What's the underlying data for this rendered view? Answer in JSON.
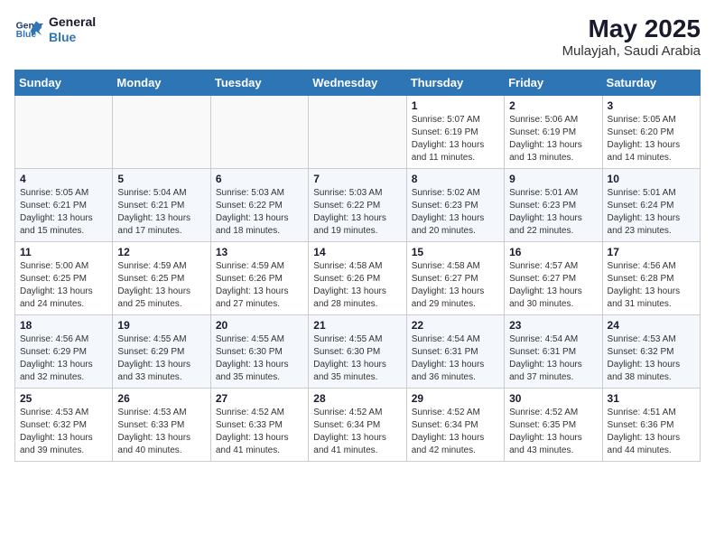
{
  "header": {
    "logo_line1": "General",
    "logo_line2": "Blue",
    "title": "May 2025",
    "subtitle": "Mulayjah, Saudi Arabia"
  },
  "weekdays": [
    "Sunday",
    "Monday",
    "Tuesday",
    "Wednesday",
    "Thursday",
    "Friday",
    "Saturday"
  ],
  "weeks": [
    [
      {
        "day": "",
        "info": ""
      },
      {
        "day": "",
        "info": ""
      },
      {
        "day": "",
        "info": ""
      },
      {
        "day": "",
        "info": ""
      },
      {
        "day": "1",
        "info": "Sunrise: 5:07 AM\nSunset: 6:19 PM\nDaylight: 13 hours\nand 11 minutes."
      },
      {
        "day": "2",
        "info": "Sunrise: 5:06 AM\nSunset: 6:19 PM\nDaylight: 13 hours\nand 13 minutes."
      },
      {
        "day": "3",
        "info": "Sunrise: 5:05 AM\nSunset: 6:20 PM\nDaylight: 13 hours\nand 14 minutes."
      }
    ],
    [
      {
        "day": "4",
        "info": "Sunrise: 5:05 AM\nSunset: 6:21 PM\nDaylight: 13 hours\nand 15 minutes."
      },
      {
        "day": "5",
        "info": "Sunrise: 5:04 AM\nSunset: 6:21 PM\nDaylight: 13 hours\nand 17 minutes."
      },
      {
        "day": "6",
        "info": "Sunrise: 5:03 AM\nSunset: 6:22 PM\nDaylight: 13 hours\nand 18 minutes."
      },
      {
        "day": "7",
        "info": "Sunrise: 5:03 AM\nSunset: 6:22 PM\nDaylight: 13 hours\nand 19 minutes."
      },
      {
        "day": "8",
        "info": "Sunrise: 5:02 AM\nSunset: 6:23 PM\nDaylight: 13 hours\nand 20 minutes."
      },
      {
        "day": "9",
        "info": "Sunrise: 5:01 AM\nSunset: 6:23 PM\nDaylight: 13 hours\nand 22 minutes."
      },
      {
        "day": "10",
        "info": "Sunrise: 5:01 AM\nSunset: 6:24 PM\nDaylight: 13 hours\nand 23 minutes."
      }
    ],
    [
      {
        "day": "11",
        "info": "Sunrise: 5:00 AM\nSunset: 6:25 PM\nDaylight: 13 hours\nand 24 minutes."
      },
      {
        "day": "12",
        "info": "Sunrise: 4:59 AM\nSunset: 6:25 PM\nDaylight: 13 hours\nand 25 minutes."
      },
      {
        "day": "13",
        "info": "Sunrise: 4:59 AM\nSunset: 6:26 PM\nDaylight: 13 hours\nand 27 minutes."
      },
      {
        "day": "14",
        "info": "Sunrise: 4:58 AM\nSunset: 6:26 PM\nDaylight: 13 hours\nand 28 minutes."
      },
      {
        "day": "15",
        "info": "Sunrise: 4:58 AM\nSunset: 6:27 PM\nDaylight: 13 hours\nand 29 minutes."
      },
      {
        "day": "16",
        "info": "Sunrise: 4:57 AM\nSunset: 6:27 PM\nDaylight: 13 hours\nand 30 minutes."
      },
      {
        "day": "17",
        "info": "Sunrise: 4:56 AM\nSunset: 6:28 PM\nDaylight: 13 hours\nand 31 minutes."
      }
    ],
    [
      {
        "day": "18",
        "info": "Sunrise: 4:56 AM\nSunset: 6:29 PM\nDaylight: 13 hours\nand 32 minutes."
      },
      {
        "day": "19",
        "info": "Sunrise: 4:55 AM\nSunset: 6:29 PM\nDaylight: 13 hours\nand 33 minutes."
      },
      {
        "day": "20",
        "info": "Sunrise: 4:55 AM\nSunset: 6:30 PM\nDaylight: 13 hours\nand 35 minutes."
      },
      {
        "day": "21",
        "info": "Sunrise: 4:55 AM\nSunset: 6:30 PM\nDaylight: 13 hours\nand 35 minutes."
      },
      {
        "day": "22",
        "info": "Sunrise: 4:54 AM\nSunset: 6:31 PM\nDaylight: 13 hours\nand 36 minutes."
      },
      {
        "day": "23",
        "info": "Sunrise: 4:54 AM\nSunset: 6:31 PM\nDaylight: 13 hours\nand 37 minutes."
      },
      {
        "day": "24",
        "info": "Sunrise: 4:53 AM\nSunset: 6:32 PM\nDaylight: 13 hours\nand 38 minutes."
      }
    ],
    [
      {
        "day": "25",
        "info": "Sunrise: 4:53 AM\nSunset: 6:32 PM\nDaylight: 13 hours\nand 39 minutes."
      },
      {
        "day": "26",
        "info": "Sunrise: 4:53 AM\nSunset: 6:33 PM\nDaylight: 13 hours\nand 40 minutes."
      },
      {
        "day": "27",
        "info": "Sunrise: 4:52 AM\nSunset: 6:33 PM\nDaylight: 13 hours\nand 41 minutes."
      },
      {
        "day": "28",
        "info": "Sunrise: 4:52 AM\nSunset: 6:34 PM\nDaylight: 13 hours\nand 41 minutes."
      },
      {
        "day": "29",
        "info": "Sunrise: 4:52 AM\nSunset: 6:34 PM\nDaylight: 13 hours\nand 42 minutes."
      },
      {
        "day": "30",
        "info": "Sunrise: 4:52 AM\nSunset: 6:35 PM\nDaylight: 13 hours\nand 43 minutes."
      },
      {
        "day": "31",
        "info": "Sunrise: 4:51 AM\nSunset: 6:36 PM\nDaylight: 13 hours\nand 44 minutes."
      }
    ]
  ]
}
